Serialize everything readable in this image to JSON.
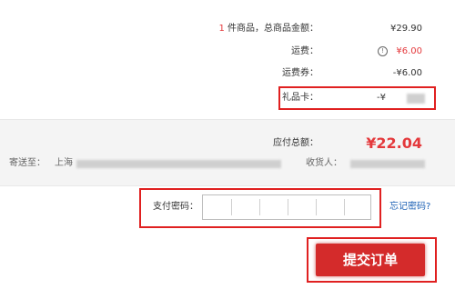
{
  "summary": {
    "item_count": "1",
    "item_label": " 件商品，总商品金额：",
    "item_total": "¥29.90",
    "shipping_label": "运费：",
    "shipping_icon": "info-icon",
    "shipping_value": "¥6.00",
    "coupon_label": "运费券：",
    "coupon_value": "-¥6.00",
    "gift_label": "礼品卡：",
    "gift_value_prefix": "-¥"
  },
  "payable": {
    "label": "应付总额：",
    "amount": "¥22.04",
    "ship_to_label": "寄送至：",
    "ship_to_city": "上海",
    "receiver_label": "收货人："
  },
  "payment": {
    "password_label": "支付密码：",
    "password_value": "",
    "forgot_label": "忘记密码?"
  },
  "actions": {
    "submit_label": "提交订单"
  },
  "colors": {
    "accent_red": "#e4393c",
    "highlight_border": "#e02020",
    "link_blue": "#1a5fb4"
  }
}
